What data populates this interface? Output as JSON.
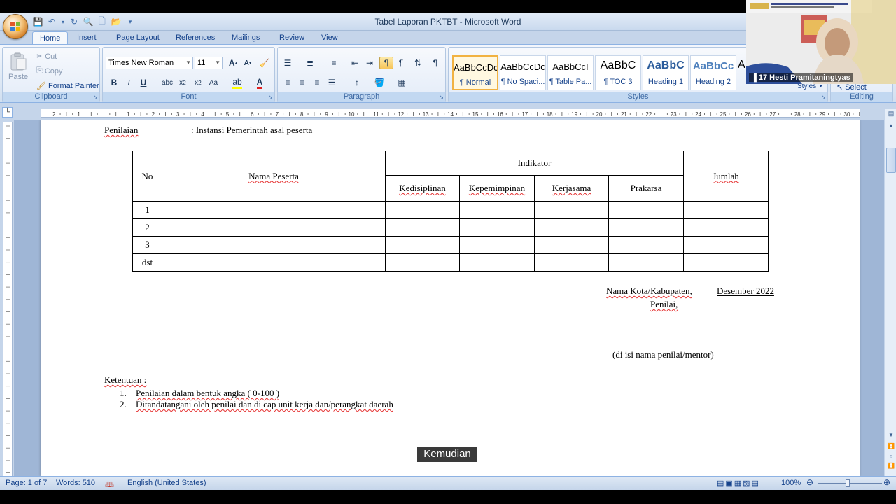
{
  "window": {
    "title": "Tabel Laporan PKTBT - Microsoft Word"
  },
  "tabs": [
    "Home",
    "Insert",
    "Page Layout",
    "References",
    "Mailings",
    "Review",
    "View"
  ],
  "active_tab": "Home",
  "clipboard": {
    "group_label": "Clipboard",
    "paste": "Paste",
    "cut": "Cut",
    "copy": "Copy",
    "format_painter": "Format Painter"
  },
  "font": {
    "group_label": "Font",
    "family": "Times New Roman",
    "size": "11"
  },
  "paragraph": {
    "group_label": "Paragraph"
  },
  "styles": {
    "group_label": "Styles",
    "change_styles": "Styles",
    "items": [
      {
        "preview": "AaBbCcDc",
        "name": "¶ Normal"
      },
      {
        "preview": "AaBbCcDc",
        "name": "¶ No Spaci..."
      },
      {
        "preview": "AaBbCcI",
        "name": "¶ Table Pa..."
      },
      {
        "preview": "AaBbC",
        "name": "¶ TOC 3"
      },
      {
        "preview": "AaBbC",
        "name": "Heading 1"
      },
      {
        "preview": "AaBbCc",
        "name": "Heading 2"
      }
    ]
  },
  "editing": {
    "group_label": "Editing",
    "select": "Select"
  },
  "document": {
    "penilaian_label": "Penilaian",
    "penilaian_value": ": Instansi Pemerintah asal peserta",
    "table": {
      "headers": {
        "no": "No",
        "nama": "Nama Peserta",
        "indikator": "Indikator",
        "jumlah": "Jumlah"
      },
      "indicators": [
        "Kedisiplinan",
        "Kepemimpinan",
        "Kerjasama",
        "Prakarsa"
      ],
      "rows": [
        "1",
        "2",
        "3",
        "dst"
      ]
    },
    "place_date": "Nama Kota/Kabupaten,",
    "month_year": "Desember  2022",
    "penilai": "Penilai,",
    "signature_note": "(di isi nama penilai/mentor)",
    "ketentuan_title": "Ketentuan :",
    "ketentuan_items": [
      {
        "num": "1.",
        "text": "Penilaian dalam bentuk angka ( 0-100 )"
      },
      {
        "num": "2.",
        "text": "Ditandatangani oleh penilai dan di cap unit kerja dan/perangkat daerah"
      }
    ]
  },
  "caption": "Kemudian",
  "status": {
    "page": "Page: 1 of 7",
    "words": "Words: 510",
    "language": "English (United States)",
    "zoom": "100%"
  },
  "webcam": {
    "name": "17 Hesti Pramitaningtyas"
  },
  "colors": {
    "ribbon_bg": "#c5d5ea",
    "accent": "#15428b",
    "style_selected": "#f1b242"
  }
}
